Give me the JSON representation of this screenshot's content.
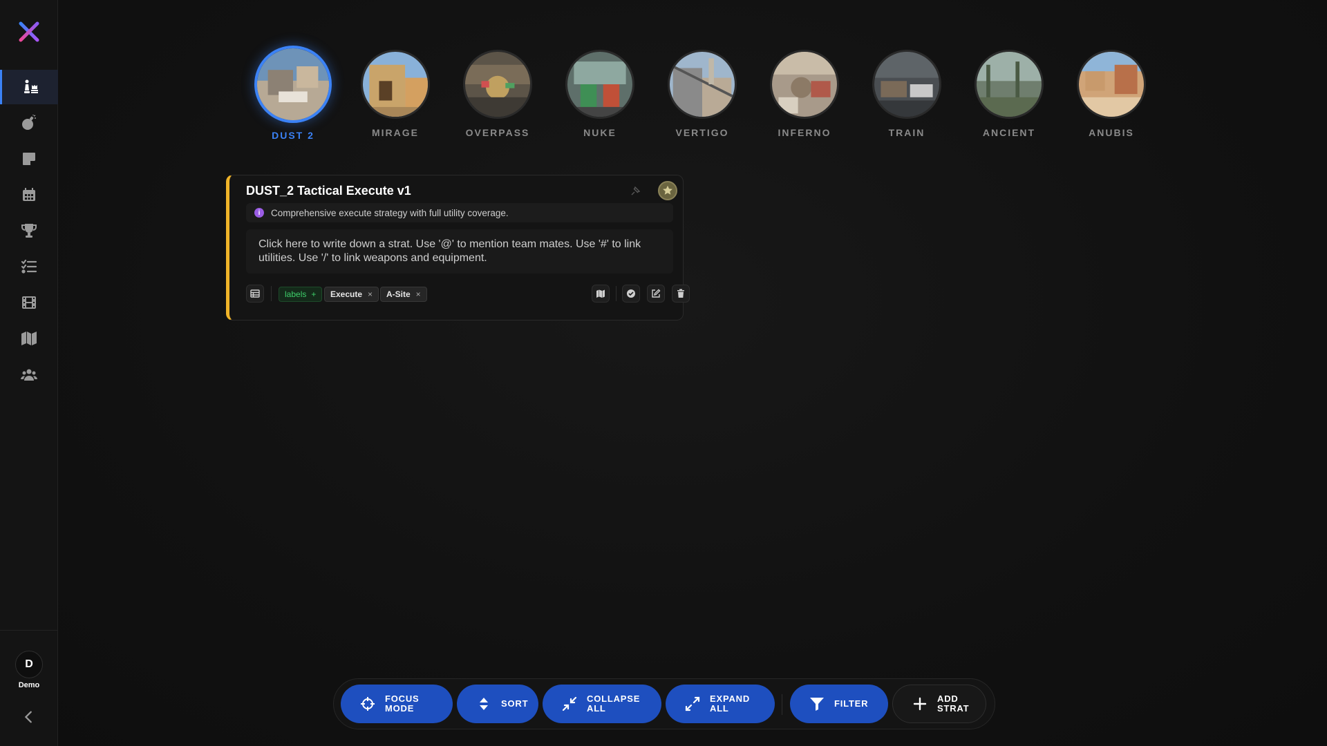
{
  "user": {
    "initial": "D",
    "name": "Demo"
  },
  "maps": [
    {
      "label": "DUST 2",
      "active": true
    },
    {
      "label": "MIRAGE",
      "active": false
    },
    {
      "label": "OVERPASS",
      "active": false
    },
    {
      "label": "NUKE",
      "active": false
    },
    {
      "label": "VERTIGO",
      "active": false
    },
    {
      "label": "INFERNO",
      "active": false
    },
    {
      "label": "TRAIN",
      "active": false
    },
    {
      "label": "ANCIENT",
      "active": false
    },
    {
      "label": "ANUBIS",
      "active": false
    }
  ],
  "strat": {
    "title": "DUST_2 Tactical Execute v1",
    "description": "Comprehensive execute strategy with full utility coverage.",
    "body": "Click here to write down a strat. Use '@' to mention team mates. Use '#' to link utilities. Use '/' to link weapons and equipment.",
    "add_label": "labels",
    "labels": [
      "Execute",
      "A-Site"
    ],
    "accent_color": "#f0b429"
  },
  "toolbar": {
    "focus_mode": [
      "FOCUS",
      "MODE"
    ],
    "sort": "SORT",
    "collapse_all": [
      "COLLAPSE",
      "ALL"
    ],
    "expand_all": [
      "EXPAND",
      "ALL"
    ],
    "filter": "FILTER",
    "add_strat": [
      "ADD",
      "STRAT"
    ]
  },
  "colors": {
    "accent": "#3b82f6",
    "button": "#1e4fbf",
    "tag_add": "#3ecf6a"
  }
}
